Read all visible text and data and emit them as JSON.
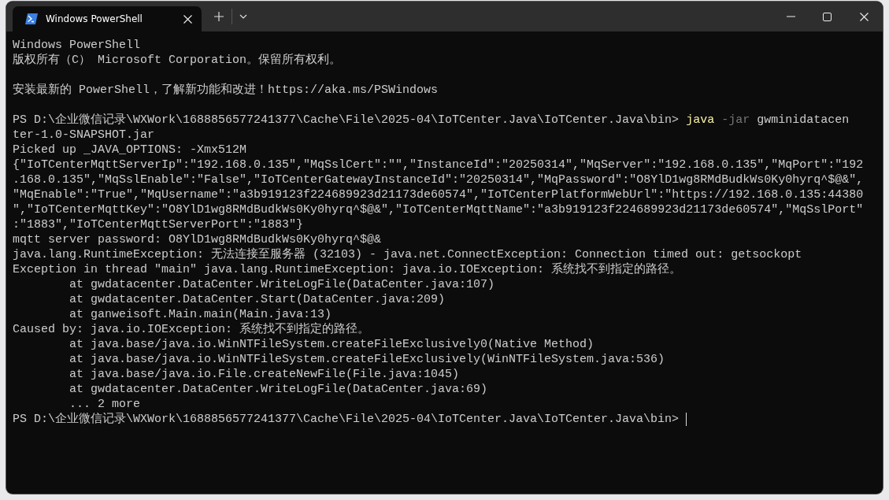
{
  "window": {
    "tabs": [
      {
        "label": "Windows PowerShell",
        "selected": true
      }
    ]
  },
  "lines": [
    {
      "kind": "text",
      "text": "Windows PowerShell"
    },
    {
      "kind": "text",
      "text": "版权所有（C） Microsoft Corporation。保留所有权利。"
    },
    {
      "kind": "blank"
    },
    {
      "kind": "text",
      "text": "安装最新的 PowerShell，了解新功能和改进！https://aka.ms/PSWindows"
    },
    {
      "kind": "blank"
    },
    {
      "kind": "prompt",
      "prompt": "PS D:\\企业微信记录\\WXWork\\1688856577241377\\Cache\\File\\2025-04\\IoTCenter.Java\\IoTCenter.Java\\bin>",
      "command": "java",
      "flag": "-jar",
      "argument": "gwminidatacen",
      "cursor": false
    },
    {
      "kind": "text",
      "text": "ter-1.0-SNAPSHOT.jar"
    },
    {
      "kind": "text",
      "text": "Picked up _JAVA_OPTIONS: -Xmx512M"
    },
    {
      "kind": "text",
      "text": "{\"IoTCenterMqttServerIp\":\"192.168.0.135\",\"MqSslCert\":\"\",\"InstanceId\":\"20250314\",\"MqServer\":\"192.168.0.135\",\"MqPort\":\"192"
    },
    {
      "kind": "text",
      "text": ".168.0.135\",\"MqSslEnable\":\"False\",\"IoTCenterGatewayInstanceId\":\"20250314\",\"MqPassword\":\"O8YlD1wg8RMdBudkWs0Ky0hyrq^$@&\","
    },
    {
      "kind": "text",
      "text": "\"MqEnable\":\"True\",\"MqUsername\":\"a3b919123f224689923d21173de60574\",\"IoTCenterPlatformWebUrl\":\"https://192.168.0.135:44380"
    },
    {
      "kind": "text",
      "text": "\",\"IoTCenterMqttKey\":\"O8YlD1wg8RMdBudkWs0Ky0hyrq^$@&\",\"IoTCenterMqttName\":\"a3b919123f224689923d21173de60574\",\"MqSslPort\""
    },
    {
      "kind": "text",
      "text": ":\"1883\",\"IoTCenterMqttServerPort\":\"1883\"}"
    },
    {
      "kind": "text",
      "text": "mqtt server password: O8YlD1wg8RMdBudkWs0Ky0hyrq^$@&"
    },
    {
      "kind": "text",
      "text": "java.lang.RuntimeException: 无法连接至服务器 (32103) - java.net.ConnectException: Connection timed out: getsockopt"
    },
    {
      "kind": "text",
      "text": "Exception in thread \"main\" java.lang.RuntimeException: java.io.IOException: 系统找不到指定的路径。"
    },
    {
      "kind": "indented",
      "text": "at gwdatacenter.DataCenter.WriteLogFile(DataCenter.java:107)"
    },
    {
      "kind": "indented",
      "text": "at gwdatacenter.DataCenter.Start(DataCenter.java:209)"
    },
    {
      "kind": "indented",
      "text": "at ganweisoft.Main.main(Main.java:13)"
    },
    {
      "kind": "text",
      "text": "Caused by: java.io.IOException: 系统找不到指定的路径。"
    },
    {
      "kind": "indented",
      "text": "at java.base/java.io.WinNTFileSystem.createFileExclusively0(Native Method)"
    },
    {
      "kind": "indented",
      "text": "at java.base/java.io.WinNTFileSystem.createFileExclusively(WinNTFileSystem.java:536)"
    },
    {
      "kind": "indented",
      "text": "at java.base/java.io.File.createNewFile(File.java:1045)"
    },
    {
      "kind": "indented",
      "text": "at gwdatacenter.DataCenter.WriteLogFile(DataCenter.java:69)"
    },
    {
      "kind": "indented",
      "text": "... 2 more"
    },
    {
      "kind": "prompt",
      "prompt": "PS D:\\企业微信记录\\WXWork\\1688856577241377\\Cache\\File\\2025-04\\IoTCenter.Java\\IoTCenter.Java\\bin>",
      "cursor": true
    }
  ]
}
